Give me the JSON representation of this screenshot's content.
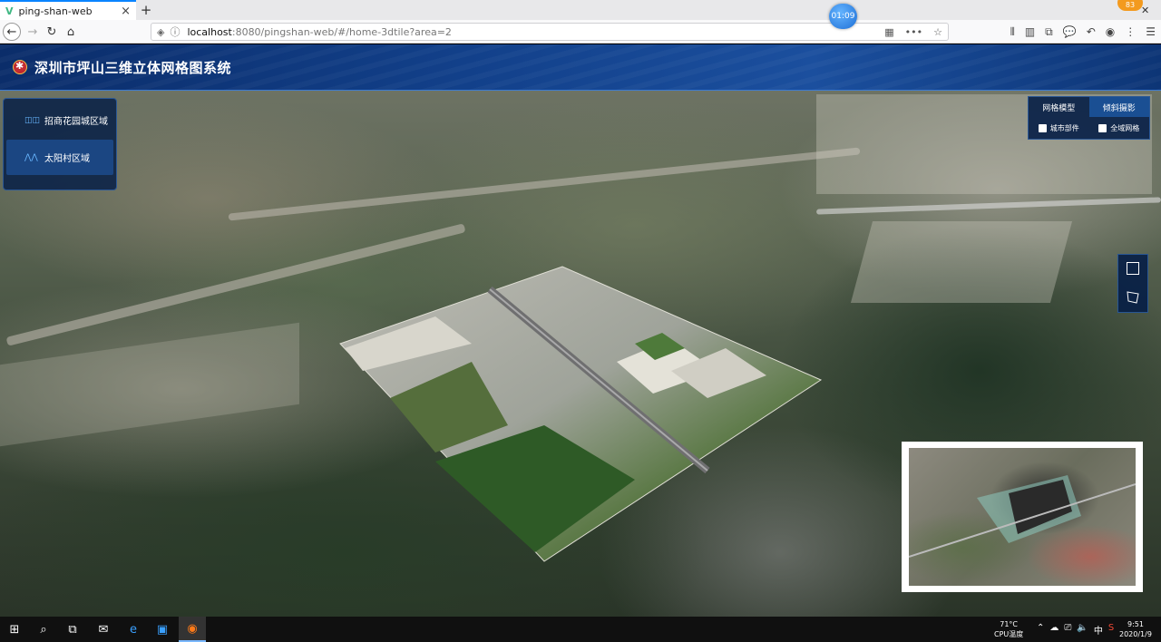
{
  "browser": {
    "tab_title": "ping-shan-web",
    "tab_favicon": "V",
    "tab_close": "×",
    "new_tab": "+",
    "url_host": "localhost",
    "url_rest": ":8080/pingshan-web/#/home-3dtile?area=2",
    "timer": "01:09",
    "notifications": "83"
  },
  "app": {
    "title": "深圳市坪山三维立体网格图系统",
    "areas": [
      {
        "label": "招商花园城区域",
        "icon": "building-area-icon"
      },
      {
        "label": "太阳村区域",
        "icon": "mountain-area-icon"
      }
    ],
    "mode_tabs": [
      "网格模型",
      "倾斜摄影"
    ],
    "checkboxes": [
      "城市部件",
      "全域网格"
    ]
  },
  "taskbar": {
    "temperature": "71°C",
    "temperature_label": "CPU温度",
    "ime": "中",
    "time": "9:51",
    "date": "2020/1/9"
  },
  "colors": {
    "header": "#12408a",
    "panel": "#061e46",
    "active": "#1a4f93",
    "accent": "#68b6ff"
  }
}
